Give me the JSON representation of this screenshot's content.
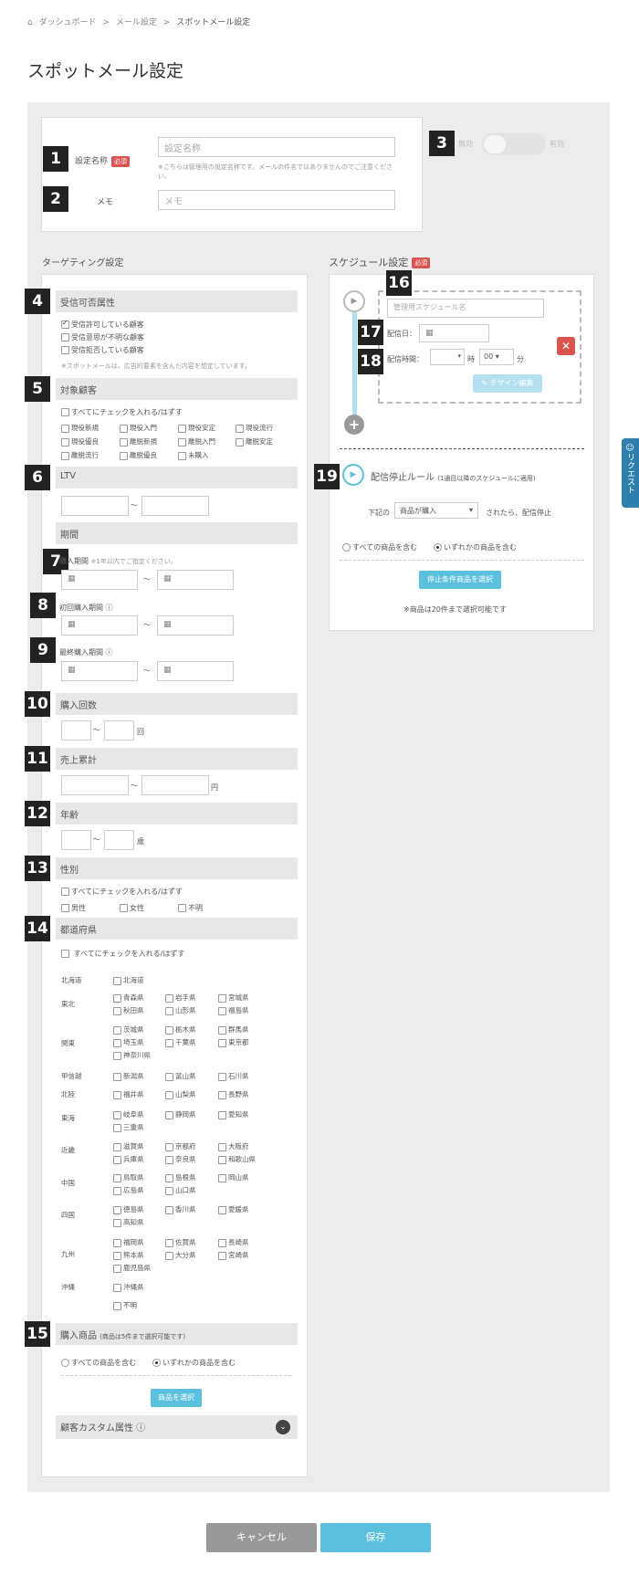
{
  "breadcrumb": {
    "home": "ダッシュボード",
    "sep": ">",
    "mail": "メール設定",
    "current": "スポットメール設定"
  },
  "page_title": "スポットメール設定",
  "required": "必須",
  "basic": {
    "name_label": "設定名称",
    "name_placeholder": "設定名称",
    "name_note": "※こちらは管理用の設定名称です。メールの件名ではありませんのでご注意ください。",
    "memo_label": "メモ",
    "memo_placeholder": "メモ"
  },
  "toggle": {
    "off": "無効",
    "on": "有効"
  },
  "markers": [
    "1",
    "2",
    "3",
    "4",
    "5",
    "6",
    "7",
    "8",
    "9",
    "10",
    "11",
    "12",
    "13",
    "14",
    "15",
    "16",
    "17",
    "18",
    "19"
  ],
  "targeting": {
    "title": "ターゲティング設定",
    "reception": {
      "title": "受信可否属性",
      "items": [
        "受信許可している顧客",
        "受信意思が不明な顧客",
        "受信拒否している顧客"
      ],
      "note": "※スポットメールは、広告的要素を含んだ内容を想定しています。"
    },
    "customers": {
      "title": "対象顧客",
      "all": "すべてにチェックを入れる/はずす",
      "row1": [
        "現役新規",
        "現役入門",
        "現役安定",
        "現役流行"
      ],
      "row2": [
        "現役優良",
        "離脱新規",
        "離脱入門",
        "離脱安定"
      ],
      "row3": [
        "離脱流行",
        "離脱優良",
        "未購入"
      ]
    },
    "ltv": {
      "title": "LTV",
      "tilde": "〜"
    },
    "period": {
      "title": "期間",
      "purchase": "購入期間",
      "purchase_note": "※1年以内でご指定ください。",
      "first": "初回購入期間",
      "last": "最終購入期間"
    },
    "count": {
      "title": "購入回数",
      "unit": "回"
    },
    "sales": {
      "title": "売上累計",
      "unit": "円"
    },
    "age": {
      "title": "年齢",
      "unit": "歳"
    },
    "gender": {
      "title": "性別",
      "all": "すべてにチェックを入れる/はずす",
      "items": [
        "男性",
        "女性",
        "不明"
      ]
    },
    "prefs": {
      "title": "都道府県",
      "all": "すべてにチェックを入れる/はずす",
      "regions": [
        "北海道",
        "東北",
        "関東",
        "甲信越",
        "北陸",
        "東海",
        "近畿",
        "中国",
        "四国",
        "九州",
        "沖縄"
      ],
      "hokkaido": [
        "北海道"
      ],
      "tohoku": [
        "青森県",
        "岩手県",
        "宮城県",
        "秋田県",
        "山形県",
        "福島県"
      ],
      "kanto": [
        "茨城県",
        "栃木県",
        "群馬県",
        "埼玉県",
        "千葉県",
        "東京都",
        "神奈川県"
      ],
      "koshinetsu": [
        "新潟県",
        "富山県",
        "石川県"
      ],
      "hokuriku": [
        "福井県",
        "山梨県",
        "長野県"
      ],
      "tokai": [
        "岐阜県",
        "静岡県",
        "愛知県",
        "三重県"
      ],
      "kinki": [
        "滋賀県",
        "京都府",
        "大阪府",
        "兵庫県",
        "奈良県",
        "和歌山県"
      ],
      "chugoku": [
        "鳥取県",
        "島根県",
        "岡山県",
        "広島県",
        "山口県"
      ],
      "shikoku": [
        "徳島県",
        "香川県",
        "愛媛県",
        "高知県"
      ],
      "kyushu": [
        "福岡県",
        "佐賀県",
        "長崎県",
        "熊本県",
        "大分県",
        "宮崎県",
        "鹿児島県"
      ],
      "okinawa": [
        "沖縄県",
        "不明"
      ]
    },
    "products": {
      "title": "購入商品",
      "note": "(商品は5件まで選択可能です)",
      "opt_all": "すべての商品を含む",
      "opt_any": "いずれかの商品を含む",
      "select": "商品を選択"
    },
    "custom": {
      "title": "顧客カスタム属性"
    }
  },
  "schedule": {
    "title": "スケジュール設定",
    "name_placeholder": "管理用スケジュール名",
    "date_label": "配信日：",
    "time_label": "配信時間：",
    "hour_unit": "時",
    "minute": "00",
    "minute_unit": "分",
    "design_edit": "✎ デザイン編集",
    "stop_rule": {
      "title": "配信停止ルール",
      "note": "(1通目以降のスケジュールに適用)",
      "prefix": "下記の",
      "select": "商品が購入",
      "suffix": "されたら、配信停止",
      "opt_all": "すべての商品を含む",
      "opt_any": "いずれかの商品を含む",
      "select_btn": "停止条件商品を選択",
      "limit_note": "※商品は20件まで選択可能です"
    }
  },
  "side_tab": "リクエスト",
  "footer": {
    "cancel": "キャンセル",
    "save": "保存"
  },
  "colors": {
    "accent": "#5bc0de",
    "cancel": "#999999",
    "required": "#d9534f",
    "marker": "#222222"
  }
}
